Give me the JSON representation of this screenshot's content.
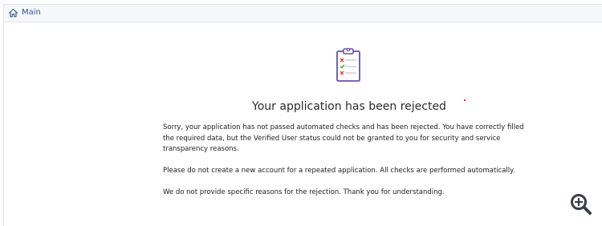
{
  "breadcrumb": {
    "label": "Main",
    "icon": "home-icon",
    "color": "#2a5a9c"
  },
  "status": {
    "icon": "clipboard-checklist-icon",
    "title": "Your application has been rejected",
    "paragraphs": [
      "Sorry, your application has not passed automated checks and has been rejected. You have correctly filled the required data, but the Verified User status could not be granted to you for security and service transparency reasons.",
      "Please do not create a new account for a repeated application. All checks are performed automatically.",
      "We do not provide specific reasons for the rejection. Thank you for understanding."
    ]
  },
  "tools": {
    "zoom_icon": "zoom-in-icon"
  },
  "colors": {
    "accent": "#6b4fa8",
    "reject": "#e0262d",
    "approve": "#3aa84a"
  }
}
